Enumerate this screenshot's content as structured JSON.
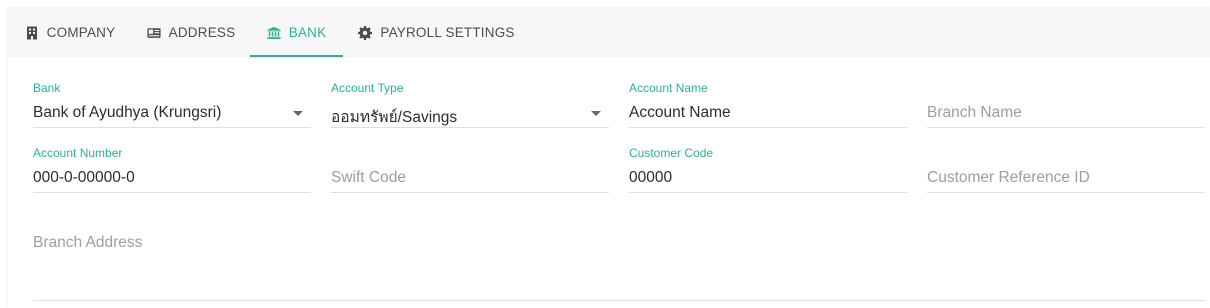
{
  "tabs": [
    {
      "label": "COMPANY",
      "icon": "building-icon"
    },
    {
      "label": "ADDRESS",
      "icon": "address-card-icon"
    },
    {
      "label": "BANK",
      "icon": "bank-icon"
    },
    {
      "label": "PAYROLL SETTINGS",
      "icon": "gear-icon"
    }
  ],
  "active_tab": "BANK",
  "accent_color": "#2bb195",
  "form": {
    "bank": {
      "label": "Bank",
      "value": "Bank of Ayudhya (Krungsri)"
    },
    "account_type": {
      "label": "Account Type",
      "value": "ออมทรัพย์/Savings"
    },
    "account_name": {
      "label": "Account Name",
      "value": "Account Name"
    },
    "branch_name": {
      "placeholder": "Branch Name"
    },
    "account_number": {
      "label": "Account Number",
      "value": "000-0-00000-0"
    },
    "swift_code": {
      "placeholder": "Swift Code"
    },
    "customer_code": {
      "label": "Customer Code",
      "value": "00000"
    },
    "customer_reference_id": {
      "placeholder": "Customer Reference ID"
    },
    "branch_address": {
      "placeholder": "Branch Address"
    }
  }
}
